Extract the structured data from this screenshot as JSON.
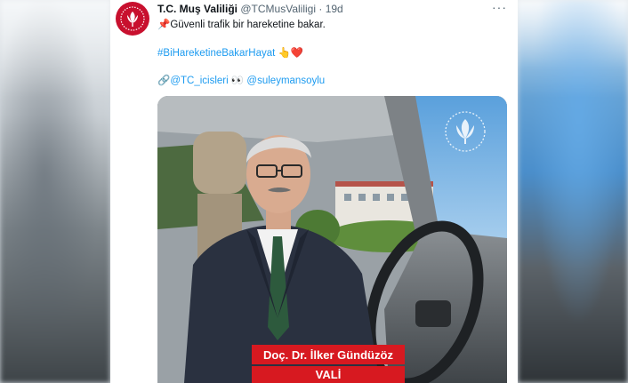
{
  "tweet": {
    "display_name": "T.C. Muş Valiliği",
    "handle": "@TCMusValiligi",
    "separator": "·",
    "time": "19d",
    "more_label": "···",
    "text_line1": "Güvenli trafik bir hareketine bakar.",
    "pin_emoji": "📌",
    "hashtag": "#BiHareketineBakarHayat",
    "hashtag_emojis": "👆❤️",
    "link_emoji": "🔗",
    "mention1": "@TC_icisleri",
    "eyes_emoji": "👀",
    "mention2": "@suleymansoylu"
  },
  "video": {
    "caption_name": "Doç. Dr. İlker Gündüzöz",
    "caption_title": "VALİ",
    "caption_color": "#d71920",
    "watermark_icon": "tulip-emblem-icon"
  },
  "colors": {
    "link": "#1d9bf0",
    "avatar": "#c8102e"
  }
}
